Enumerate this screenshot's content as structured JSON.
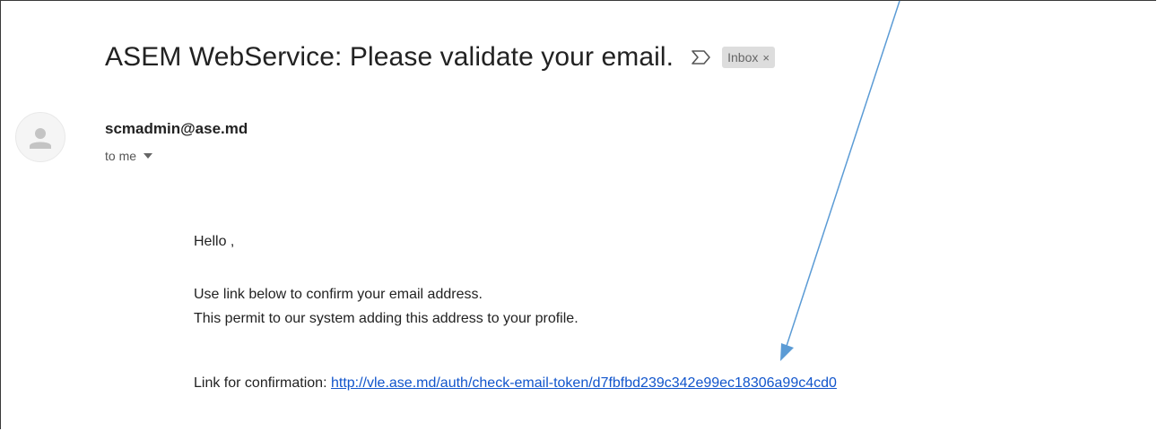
{
  "email": {
    "subject": "ASEM WebService: Please validate your email.",
    "label_chip": "Inbox",
    "label_chip_close": "×",
    "sender": "scmadmin@ase.md",
    "recipients": "to me"
  },
  "body": {
    "greeting": "Hello ,",
    "line1": "Use link below to confirm your email address.",
    "line2": "This permit to our system adding this address to your profile.",
    "link_prefix": "Link for confirmation:",
    "link_text": "http://vle.ase.md/auth/check-email-token/d7fbfbd239c342e99ec18306a99c4cd0"
  },
  "icons": {
    "important": "important-marker-icon",
    "avatar": "person-avatar-icon",
    "dropdown": "chevron-down-icon",
    "annotation": "annotation-arrow"
  },
  "colors": {
    "link": "#1155cc",
    "annotation_arrow": "#5b9bd5",
    "chip_bg": "#dddddd"
  }
}
